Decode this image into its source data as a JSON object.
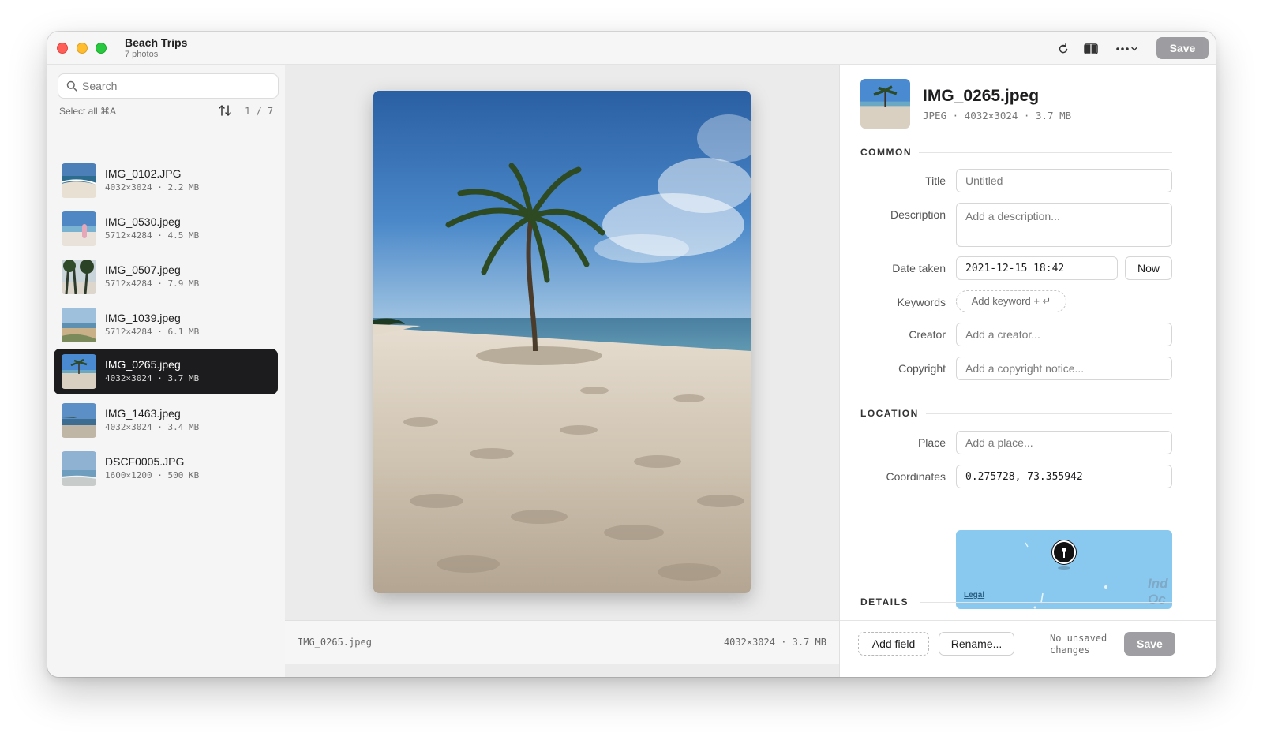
{
  "window": {
    "title": "Beach Trips",
    "subtitle": "7 photos",
    "save_label": "Save"
  },
  "toolbar": {
    "icons": [
      "refresh-icon",
      "split-view-icon",
      "more-icon"
    ]
  },
  "sidebar": {
    "search_placeholder": "Search",
    "select_all_label": "Select all ⌘A",
    "counter": "1 / 7",
    "files": [
      {
        "name": "IMG_0102.JPG",
        "meta": "4032×3024 · 2.2 MB",
        "selected": false
      },
      {
        "name": "IMG_0530.jpeg",
        "meta": "5712×4284 · 4.5 MB",
        "selected": false
      },
      {
        "name": "IMG_0507.jpeg",
        "meta": "5712×4284 · 7.9 MB",
        "selected": false
      },
      {
        "name": "IMG_1039.jpeg",
        "meta": "5712×4284 · 6.1 MB",
        "selected": false
      },
      {
        "name": "IMG_0265.jpeg",
        "meta": "4032×3024 · 3.7 MB",
        "selected": true
      },
      {
        "name": "IMG_1463.jpeg",
        "meta": "4032×3024 · 3.4 MB",
        "selected": false
      },
      {
        "name": "DSCF0005.JPG",
        "meta": "1600×1200 · 500 KB",
        "selected": false
      }
    ]
  },
  "preview": {
    "footer_name": "IMG_0265.jpeg",
    "footer_meta": "4032×3024 · 3.7 MB"
  },
  "inspector": {
    "name": "IMG_0265.jpeg",
    "meta": "JPEG · 4032×3024 · 3.7 MB",
    "sections": {
      "common": "COMMON",
      "location": "LOCATION",
      "details": "DETAILS"
    },
    "fields": {
      "title_label": "Title",
      "title_placeholder": "Untitled",
      "description_label": "Description",
      "description_placeholder": "Add a description...",
      "date_label": "Date taken",
      "date_value": "2021-12-15 18:42",
      "now_label": "Now",
      "keywords_label": "Keywords",
      "keyword_add": "Add keyword + ↵",
      "creator_label": "Creator",
      "creator_placeholder": "Add a creator...",
      "copyright_label": "Copyright",
      "copyright_placeholder": "Add a copyright notice...",
      "place_label": "Place",
      "place_placeholder": "Add a place...",
      "coordinates_label": "Coordinates",
      "coordinates_value": "0.275728, 73.355942"
    },
    "map": {
      "legal": "Legal",
      "ocean_line1": "Ind",
      "ocean_line2": "Oc"
    },
    "footer": {
      "add_field": "Add field",
      "rename": "Rename...",
      "status": "No unsaved changes",
      "save": "Save"
    }
  },
  "colors": {
    "selected_row": "#1c1c1e",
    "disabled_button": "#8e8e93",
    "map_water": "#8fcdf2"
  }
}
